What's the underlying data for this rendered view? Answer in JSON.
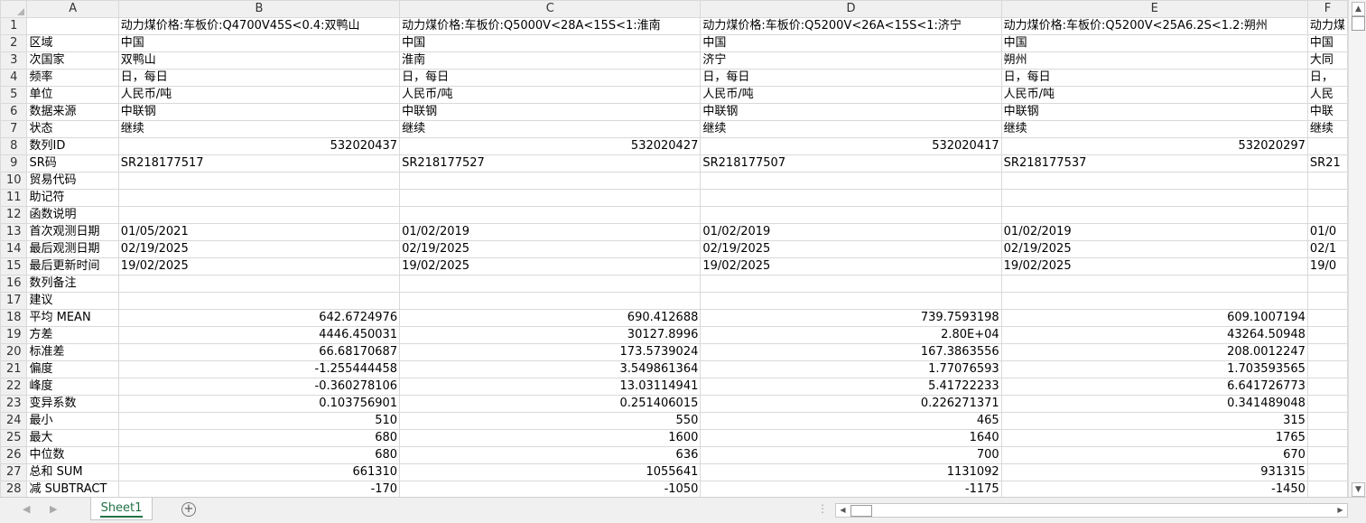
{
  "columns": [
    "A",
    "B",
    "C",
    "D",
    "E",
    "F"
  ],
  "rows": [
    {
      "n": "1",
      "cells": [
        "",
        "动力煤价格:车板价:Q4700V45S<0.4:双鸭山",
        "动力煤价格:车板价:Q5000V<28A<15S<1:淮南",
        "动力煤价格:车板价:Q5200V<26A<15S<1:济宁",
        "动力煤价格:车板价:Q5200V<25A6.2S<1.2:朔州",
        "动力煤"
      ]
    },
    {
      "n": "2",
      "cells": [
        "区域",
        "中国",
        "中国",
        "中国",
        "中国",
        "中国"
      ]
    },
    {
      "n": "3",
      "cells": [
        "次国家",
        "双鸭山",
        "淮南",
        "济宁",
        "朔州",
        "大同"
      ]
    },
    {
      "n": "4",
      "cells": [
        "频率",
        "日，每日",
        "日，每日",
        "日，每日",
        "日，每日",
        "日，"
      ]
    },
    {
      "n": "5",
      "cells": [
        "单位",
        "人民币/吨",
        "人民币/吨",
        "人民币/吨",
        "人民币/吨",
        "人民"
      ]
    },
    {
      "n": "6",
      "cells": [
        "数据来源",
        "中联钢",
        "中联钢",
        "中联钢",
        "中联钢",
        "中联"
      ]
    },
    {
      "n": "7",
      "cells": [
        "状态",
        "继续",
        "继续",
        "继续",
        "继续",
        "继续"
      ]
    },
    {
      "n": "8",
      "cells": [
        "数列ID",
        "532020437",
        "532020427",
        "532020417",
        "532020297",
        ""
      ]
    },
    {
      "n": "9",
      "cells": [
        "SR码",
        "SR218177517",
        "SR218177527",
        "SR218177507",
        "SR218177537",
        "SR21"
      ]
    },
    {
      "n": "10",
      "cells": [
        "贸易代码",
        "",
        "",
        "",
        "",
        ""
      ]
    },
    {
      "n": "11",
      "cells": [
        "助记符",
        "",
        "",
        "",
        "",
        ""
      ]
    },
    {
      "n": "12",
      "cells": [
        "函数说明",
        "",
        "",
        "",
        "",
        ""
      ]
    },
    {
      "n": "13",
      "cells": [
        "首次观测日期",
        "01/05/2021",
        "01/02/2019",
        "01/02/2019",
        "01/02/2019",
        "01/0"
      ]
    },
    {
      "n": "14",
      "cells": [
        "最后观测日期",
        "02/19/2025",
        "02/19/2025",
        "02/19/2025",
        "02/19/2025",
        "02/1"
      ]
    },
    {
      "n": "15",
      "cells": [
        "最后更新时间",
        "19/02/2025",
        "19/02/2025",
        "19/02/2025",
        "19/02/2025",
        "19/0"
      ]
    },
    {
      "n": "16",
      "cells": [
        "数列备注",
        "",
        "",
        "",
        "",
        ""
      ]
    },
    {
      "n": "17",
      "cells": [
        "建议",
        "",
        "",
        "",
        "",
        ""
      ]
    },
    {
      "n": "18",
      "cells": [
        "平均 MEAN",
        "642.6724976",
        "690.412688",
        "739.7593198",
        "609.1007194",
        ""
      ]
    },
    {
      "n": "19",
      "cells": [
        "方差",
        "4446.450031",
        "30127.8996",
        "2.80E+04",
        "43264.50948",
        ""
      ]
    },
    {
      "n": "20",
      "cells": [
        "标准差",
        "66.68170687",
        "173.5739024",
        "167.3863556",
        "208.0012247",
        ""
      ]
    },
    {
      "n": "21",
      "cells": [
        "偏度",
        "-1.255444458",
        "3.549861364",
        "1.77076593",
        "1.703593565",
        ""
      ]
    },
    {
      "n": "22",
      "cells": [
        "峰度",
        "-0.360278106",
        "13.03114941",
        "5.41722233",
        "6.641726773",
        ""
      ]
    },
    {
      "n": "23",
      "cells": [
        "变异系数",
        "0.103756901",
        "0.251406015",
        "0.226271371",
        "0.341489048",
        ""
      ]
    },
    {
      "n": "24",
      "cells": [
        "最小",
        "510",
        "550",
        "465",
        "315",
        ""
      ]
    },
    {
      "n": "25",
      "cells": [
        "最大",
        "680",
        "1600",
        "1640",
        "1765",
        ""
      ]
    },
    {
      "n": "26",
      "cells": [
        "中位数",
        "680",
        "636",
        "700",
        "670",
        ""
      ]
    },
    {
      "n": "27",
      "cells": [
        "总和 SUM",
        "661310",
        "1055641",
        "1131092",
        "931315",
        ""
      ]
    },
    {
      "n": "28",
      "cells": [
        "减 SUBTRACT",
        "-170",
        "-1050",
        "-1175",
        "-1450",
        ""
      ]
    }
  ],
  "sheet_tab": "Sheet1",
  "add_sheet_symbol": "+",
  "icons": {
    "scroll_up": "▲",
    "scroll_down": "▼",
    "scroll_left": "◀",
    "scroll_right": "▶",
    "tab_prev": "◀",
    "tab_next": "▶",
    "more": "⋮"
  }
}
